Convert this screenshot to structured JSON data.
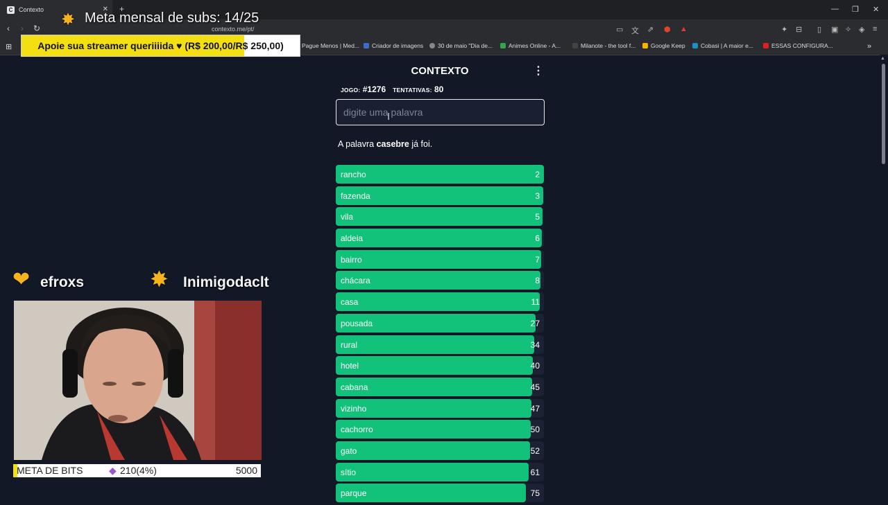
{
  "browser": {
    "tab_title": "Contexto",
    "url": "contexto.me/pt/",
    "bookmarks": [
      {
        "label": "Pague Menos | Med...",
        "color": "#d33"
      },
      {
        "label": "Criador de imagens",
        "color": "#3b6ec9"
      },
      {
        "label": "30 de maio \"Dia de...",
        "color": "#888"
      },
      {
        "label": "Animes Online - A...",
        "color": "#2fa84f"
      },
      {
        "label": "Milanote - the tool f...",
        "color": "#444"
      },
      {
        "label": "Google Keep",
        "color": "#f4b400"
      },
      {
        "label": "Cobasi | A maior e...",
        "color": "#1c8fc4"
      },
      {
        "label": "ESSAS CONFIGURA...",
        "color": "#e02020"
      }
    ]
  },
  "overlay": {
    "meta_mensal": "Meta mensal de subs: 14/25",
    "donation_text": "Apoie sua streamer queriiiida ♥ (R$ 200,00/R$ 250,00)",
    "donation_progress": 0.8,
    "streamer_1": "efroxs",
    "streamer_2": "Inimigodaclt",
    "bits_label": "META DE BITS",
    "bits_progress": "210(4%)",
    "bits_goal": "5000",
    "accent": "#f4df12"
  },
  "contexto": {
    "title": "CONTEXTO",
    "game_label": "JOGO:",
    "game_number": "#1276",
    "attempts_label": "TENTATIVAS:",
    "attempts": "80",
    "input_placeholder": "digite uma palavra",
    "msg_prefix": "A palavra",
    "msg_word": "casebre",
    "msg_suffix": "já foi.",
    "bar_color": "#13c27a",
    "guesses": [
      {
        "word": "rancho",
        "rank": "2",
        "fill": 1.0
      },
      {
        "word": "fazenda",
        "rank": "3",
        "fill": 0.997
      },
      {
        "word": "vila",
        "rank": "5",
        "fill": 0.993
      },
      {
        "word": "aldeia",
        "rank": "6",
        "fill": 0.99
      },
      {
        "word": "bairro",
        "rank": "7",
        "fill": 0.987
      },
      {
        "word": "chácara",
        "rank": "8",
        "fill": 0.983
      },
      {
        "word": "casa",
        "rank": "11",
        "fill": 0.98
      },
      {
        "word": "pousada",
        "rank": "27",
        "fill": 0.96
      },
      {
        "word": "rural",
        "rank": "34",
        "fill": 0.953
      },
      {
        "word": "hotel",
        "rank": "40",
        "fill": 0.947
      },
      {
        "word": "cabana",
        "rank": "45",
        "fill": 0.943
      },
      {
        "word": "vizinho",
        "rank": "47",
        "fill": 0.94
      },
      {
        "word": "cachorro",
        "rank": "50",
        "fill": 0.937
      },
      {
        "word": "gato",
        "rank": "52",
        "fill": 0.933
      },
      {
        "word": "sítio",
        "rank": "61",
        "fill": 0.927
      },
      {
        "word": "parque",
        "rank": "75",
        "fill": 0.913
      }
    ]
  }
}
